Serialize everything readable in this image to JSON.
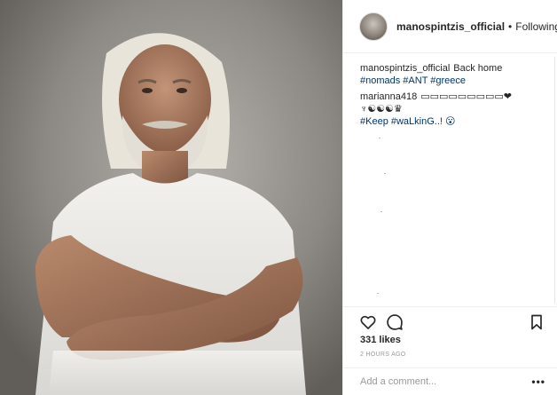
{
  "post": {
    "username": "manospintzis_official",
    "separator": "•",
    "follow_status": "Following"
  },
  "comments": [
    {
      "user": "manospintzis_official",
      "text": "Back home",
      "hashtags": "#nomads #ANT #greece"
    },
    {
      "user": "marianna418",
      "text": "▭▭▭▭▭▭▭▭▭❤︎♆☯☯☯♛",
      "hashtags": "#Keep #waLkinG..! 😮"
    }
  ],
  "engagement": {
    "likes": "331 likes",
    "time_ago": "2 HOURS AGO"
  },
  "composer": {
    "placeholder": "Add a comment...",
    "more_label": "•••"
  },
  "colors": {
    "link_blue": "#003569",
    "text_dark": "#262626",
    "muted_gray": "#999999",
    "border": "#efefef"
  },
  "icons": [
    "heart-icon",
    "comment-icon",
    "bookmark-icon",
    "more-options-icon"
  ]
}
